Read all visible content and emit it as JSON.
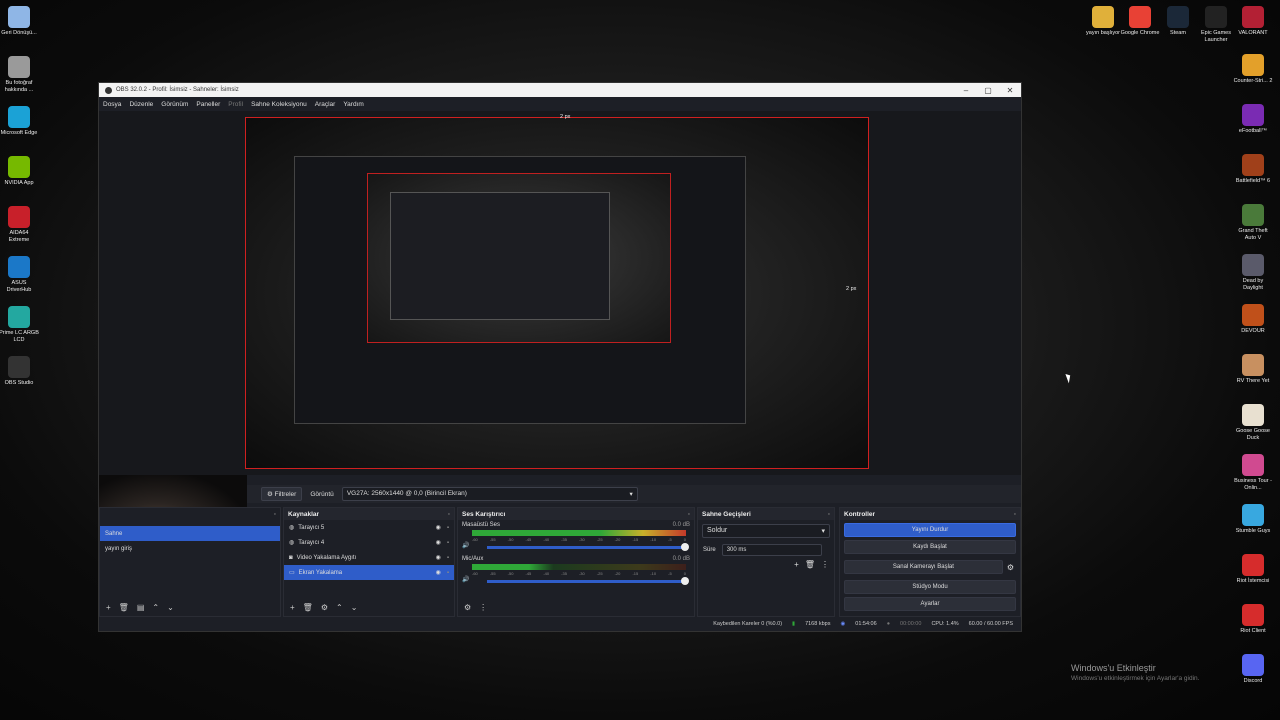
{
  "desktop_left": [
    {
      "label": "Geri Dönüşü...",
      "color": "#8fb6e6",
      "icon": "recycle-bin-icon"
    },
    {
      "label": "Bu fotoğraf hakkında ...",
      "color": "#9a9a9a",
      "icon": "camera-icon"
    },
    {
      "label": "Microsoft Edge",
      "color": "#1ba2d6",
      "icon": "edge-icon"
    },
    {
      "label": "NVIDIA App",
      "color": "#76b900",
      "icon": "nvidia-icon"
    },
    {
      "label": "AIDA64 Extreme",
      "color": "#c8202a",
      "icon": "aida64-icon"
    },
    {
      "label": "ASUS DriverHub",
      "color": "#1b78c8",
      "icon": "asus-icon"
    },
    {
      "label": "Prime LC ARGB LCD",
      "color": "#23a8a0",
      "icon": "prime-lc-icon"
    },
    {
      "label": "OBS Studio",
      "color": "#333333",
      "icon": "obs-icon"
    }
  ],
  "desktop_top": [
    {
      "label": "yayın başlıyor",
      "color": "#e0b03a",
      "icon": "folder-icon"
    },
    {
      "label": "Google Chrome",
      "color": "#e84135",
      "icon": "chrome-icon"
    },
    {
      "label": "Steam",
      "color": "#1b2838",
      "icon": "steam-icon"
    },
    {
      "label": "Epic Games Launcher",
      "color": "#222222",
      "icon": "epic-icon"
    },
    {
      "label": "VALORANT",
      "color": "#b32034",
      "icon": "valorant-icon"
    }
  ],
  "desktop_right": [
    {
      "label": "Counter-Stri... 2",
      "color": "#e3a02a",
      "icon": "cs2-icon"
    },
    {
      "label": "eFootball™",
      "color": "#7a2bb3",
      "icon": "efootball-icon"
    },
    {
      "label": "Battlefield™ 6",
      "color": "#a0401a",
      "icon": "battlefield-icon"
    },
    {
      "label": "Grand Theft Auto V",
      "color": "#4a7a3a",
      "icon": "gta-icon"
    },
    {
      "label": "Dead by Daylight",
      "color": "#5a5a6a",
      "icon": "dbd-icon"
    },
    {
      "label": "DEVOUR",
      "color": "#c0501a",
      "icon": "devour-icon"
    },
    {
      "label": "RV There Yet",
      "color": "#c89060",
      "icon": "rv-icon"
    },
    {
      "label": "Goose Goose Duck",
      "color": "#e8e0d0",
      "icon": "goose-icon"
    },
    {
      "label": "Business Tour - Onlin...",
      "color": "#d04a90",
      "icon": "business-tour-icon"
    },
    {
      "label": "Stumble Guys",
      "color": "#38a8e0",
      "icon": "stumble-icon"
    },
    {
      "label": "Riot İstemcisi",
      "color": "#d62c2c",
      "icon": "riot-icon"
    },
    {
      "label": "Riot Client",
      "color": "#d62c2c",
      "icon": "riot-client-icon"
    },
    {
      "label": "Discord",
      "color": "#5865f2",
      "icon": "discord-icon"
    }
  ],
  "window": {
    "title": "OBS 32.0.2 - Profil: İsimsiz - Sahneler: İsimsiz",
    "menu": [
      "Dosya",
      "Düzenle",
      "Görünüm",
      "Paneller"
    ],
    "menu_disabled": "Profil",
    "menu2": [
      "Sahne Koleksiyonu",
      "Araçlar",
      "Yardım"
    ],
    "preview_top_label": "2 px",
    "preview_right_label": "2 px"
  },
  "toolbar": {
    "filters_label": "Filtreler",
    "view_label": "Görüntü",
    "source_select": "VG27A: 2560x1440 @ 0,0 (Birincil Ekran)"
  },
  "scenes": {
    "items": [
      "Sahne",
      "yayın giriş"
    ]
  },
  "sources": {
    "title": "Kaynaklar",
    "items": [
      "Tarayıcı 5",
      "Tarayıcı 4",
      "Video Yakalama Aygıtı",
      "Ekran Yakalama"
    ]
  },
  "mixer": {
    "title": "Ses Karıştırıcı",
    "tracks": [
      {
        "name": "Masaüstü Ses",
        "db": "0.0 dB",
        "level": 0.88
      },
      {
        "name": "Mic/Aux",
        "db": "0.0 dB",
        "level": 0.38
      }
    ],
    "ticks": [
      "-60",
      "-55",
      "-50",
      "-45",
      "-40",
      "-35",
      "-30",
      "-25",
      "-20",
      "-15",
      "-10",
      "-5",
      "0"
    ]
  },
  "transitions": {
    "title": "Sahne Geçişleri",
    "type": "Soldur",
    "duration_label": "Süre",
    "duration_value": "300 ms"
  },
  "controls": {
    "title": "Kontroller",
    "buttons": [
      "Yayını Durdur",
      "Kaydı Başlat",
      "Sanal Kamerayı Başlat",
      "Stüdyo Modu",
      "Ayarlar"
    ]
  },
  "status": {
    "dropped": "Kaybedilen Kareler 0 (%0.0)",
    "bitrate": "7168 kbps",
    "stream_time": "01:54:06",
    "rec_time": "00:00:00",
    "cpu": "CPU: 1.4%",
    "fps": "60.00 / 60.00 FPS"
  },
  "activation": {
    "title": "Windows'u Etkinleştir",
    "subtitle": "Windows'u etkinleştirmek için Ayarlar'a gidin."
  }
}
